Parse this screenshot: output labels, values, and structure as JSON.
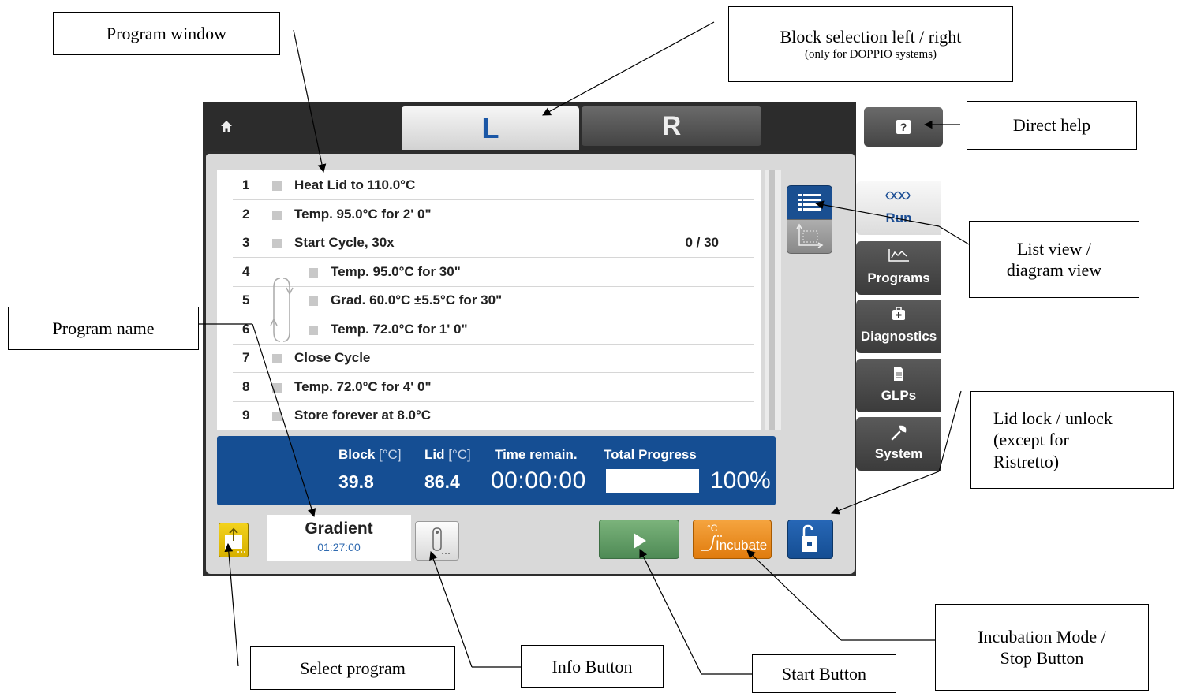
{
  "device": {
    "block_tabs": [
      {
        "label": "L"
      },
      {
        "label": "R"
      }
    ],
    "help_glyph": "?",
    "steps": [
      {
        "num": "1",
        "text": "Heat Lid to 110.0°C",
        "indent": 0,
        "counter": ""
      },
      {
        "num": "2",
        "text": "Temp.  95.0°C for 2' 0\"",
        "indent": 0,
        "counter": ""
      },
      {
        "num": "3",
        "text": "Start Cycle, 30x",
        "indent": 0,
        "counter": "0 / 30"
      },
      {
        "num": "4",
        "text": "Temp.  95.0°C for 30\"",
        "indent": 1,
        "counter": ""
      },
      {
        "num": "5",
        "text": "Grad.  60.0°C ±5.5°C  for 30\"",
        "indent": 1,
        "counter": ""
      },
      {
        "num": "6",
        "text": "Temp.  72.0°C for 1' 0\"",
        "indent": 1,
        "counter": ""
      },
      {
        "num": "7",
        "text": "Close Cycle",
        "indent": 0,
        "counter": ""
      },
      {
        "num": "8",
        "text": "Temp.  72.0°C for 4' 0\"",
        "indent": 0,
        "counter": ""
      },
      {
        "num": "9",
        "text": "Store forever at 8.0°C",
        "indent": 0,
        "counter": ""
      }
    ],
    "status": {
      "block_label": "Block",
      "block_unit": "[°C]",
      "block_value": "39.8",
      "lid_label": "Lid",
      "lid_unit": "[°C]",
      "lid_value": "86.4",
      "time_label": "Time remain.",
      "time_value": "00:00:00",
      "progress_label": "Total Progress",
      "progress_percent": "100%",
      "progress_fraction": 1.0
    },
    "program": {
      "name": "Gradient",
      "duration": "01:27:00"
    },
    "incubate_label": "Incubate",
    "incubate_unit": "°C",
    "side_tabs": [
      {
        "label": "Run",
        "icon": "dna-icon"
      },
      {
        "label": "Programs",
        "icon": "chart-icon"
      },
      {
        "label": "Diagnostics",
        "icon": "medkit-icon"
      },
      {
        "label": "GLPs",
        "icon": "document-icon"
      },
      {
        "label": "System",
        "icon": "wrench-icon"
      }
    ]
  },
  "callouts": {
    "program_window": "Program window",
    "block_selection": "Block selection left / right",
    "block_selection_note": "(only for DOPPIO systems)",
    "direct_help": "Direct help",
    "list_view_line1": "List view /",
    "list_view_line2": "diagram view",
    "program_name": "Program name",
    "lid_lock_line1": "Lid lock / unlock",
    "lid_lock_line2": "(except for",
    "lid_lock_line3": "Ristretto)",
    "select_program": "Select program",
    "info_button": "Info Button",
    "start_button": "Start Button",
    "incubation_line1": "Incubation Mode /",
    "incubation_line2": "Stop Button"
  },
  "colors": {
    "accent": "#154e93",
    "incubate": "#e8890f",
    "start": "#5f9a66",
    "select_program": "#e6c20a"
  }
}
